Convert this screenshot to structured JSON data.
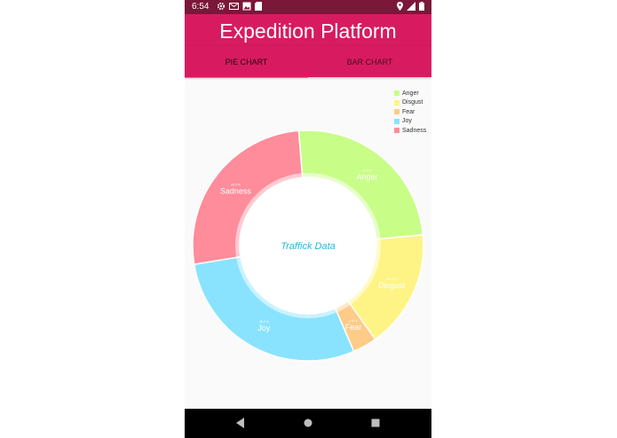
{
  "status_bar": {
    "time": "6:54",
    "left_icons": [
      "gear-icon",
      "mail-icon",
      "image-icon",
      "sd-card-icon"
    ],
    "right_icons": [
      "location-icon",
      "signal-icon",
      "battery-icon"
    ]
  },
  "app_bar": {
    "title": "Expedition Platform",
    "color": "#d81b60"
  },
  "tabs": [
    {
      "label": "PIE CHART",
      "active": true
    },
    {
      "label": "BAR CHART",
      "active": false
    }
  ],
  "nav_bar": {
    "buttons": [
      "back-icon",
      "home-icon",
      "recents-icon"
    ]
  },
  "chart_data": {
    "type": "pie",
    "donut": true,
    "center_text": "Traffick Data",
    "legend_position": "top-right",
    "categories": [
      "Anger",
      "Disgust",
      "Fear",
      "Joy",
      "Sadness"
    ],
    "values": [
      24.8,
      16.6,
      3.4,
      28.9,
      26.3
    ],
    "colors": [
      "#c8fd88",
      "#fef486",
      "#fecb88",
      "#89e3fe",
      "#fe8c9b"
    ],
    "slice_percent_labels": [
      "24.8 %",
      "16.6 %",
      "3.4 %",
      "28.9 %",
      "26.3 %"
    ]
  }
}
